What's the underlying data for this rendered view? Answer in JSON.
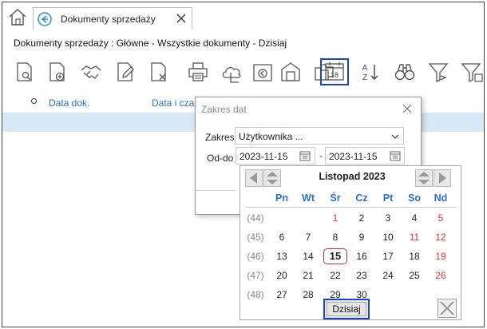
{
  "tab": {
    "label": "Dokumenty sprzedaży"
  },
  "breadcrumb": "Dokumenty sprzedaży : Główne - Wszystkie dokumenty - Dzisiaj",
  "toolbar": {
    "items": [
      "preview-icon",
      "add-document-icon",
      "handshake-icon",
      "edit-document-icon",
      "delete-document-icon",
      "print-icon",
      "cloud-icon",
      "import-icon",
      "warehouse-icon",
      "folders-icon",
      "calendar-icon",
      "sort-az-icon",
      "binoculars-icon",
      "filter-icon",
      "filter-clear-icon"
    ],
    "calendar_day": "18"
  },
  "columns": {
    "date": "Data dok.",
    "datetime": "Data i czas"
  },
  "range_dialog": {
    "title": "Zakres dat",
    "zakres_label": "Zakres",
    "zakres_value": "Użytkownika ...",
    "oddo_label": "Od-do",
    "from": "2023-11-15",
    "separator": "-",
    "to": "2023-11-15"
  },
  "calendar": {
    "month_label": "Listopad 2023",
    "weekdays": [
      "Pn",
      "Wt",
      "Śr",
      "Cz",
      "Pt",
      "So",
      "Nd"
    ],
    "weeks": [
      {
        "week": "(44)",
        "days": [
          "",
          "",
          "1",
          "2",
          "3",
          "4",
          "5"
        ]
      },
      {
        "week": "(45)",
        "days": [
          "6",
          "7",
          "8",
          "9",
          "10",
          "11",
          "12"
        ]
      },
      {
        "week": "(46)",
        "days": [
          "13",
          "14",
          "15",
          "16",
          "17",
          "18",
          "19"
        ]
      },
      {
        "week": "(47)",
        "days": [
          "20",
          "21",
          "22",
          "23",
          "24",
          "25",
          "26"
        ]
      },
      {
        "week": "(48)",
        "days": [
          "27",
          "28",
          "29",
          "30",
          "",
          "",
          ""
        ]
      }
    ],
    "today_label": "Dzisiaj",
    "selected_day": "15",
    "holidays": [
      "1",
      "11"
    ],
    "colors": {
      "weekday": "#2a6fcb",
      "sunday": "#e03030",
      "selected_border": "#b5303a",
      "highlight_border": "#1f3fd0"
    }
  }
}
